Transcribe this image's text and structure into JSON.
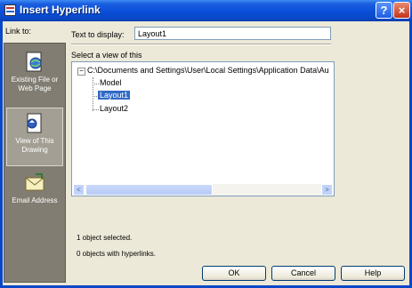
{
  "window": {
    "title": "Insert Hyperlink",
    "help_button": "?",
    "close_button": "×"
  },
  "sidebar": {
    "heading": "Link to:",
    "items": [
      {
        "label": "Existing File or Web Page",
        "icon": "web-page-icon",
        "selected": false
      },
      {
        "label": "View of This Drawing",
        "icon": "drawing-view-icon",
        "selected": true
      },
      {
        "label": "Email Address",
        "icon": "email-icon",
        "selected": false
      }
    ]
  },
  "form": {
    "text_to_display_label": "Text to display:",
    "text_to_display_value": "Layout1",
    "select_view_label": "Select a view of this"
  },
  "tree": {
    "expander": "−",
    "root": "C:\\Documents and Settings\\User\\Local Settings\\Application Data\\Au",
    "children": [
      "Model",
      "Layout1",
      "Layout2"
    ],
    "selected": "Layout1"
  },
  "scrollbar": {
    "left_arrow": "<",
    "right_arrow": ">"
  },
  "status": {
    "line1": "1 object selected.",
    "line2": "0 objects with hyperlinks."
  },
  "buttons": {
    "ok": "OK",
    "cancel": "Cancel",
    "help": "Help"
  },
  "colors": {
    "titlebar": "#0a48c8",
    "selection": "#316ac5",
    "dialog_bg": "#ece9d8"
  }
}
